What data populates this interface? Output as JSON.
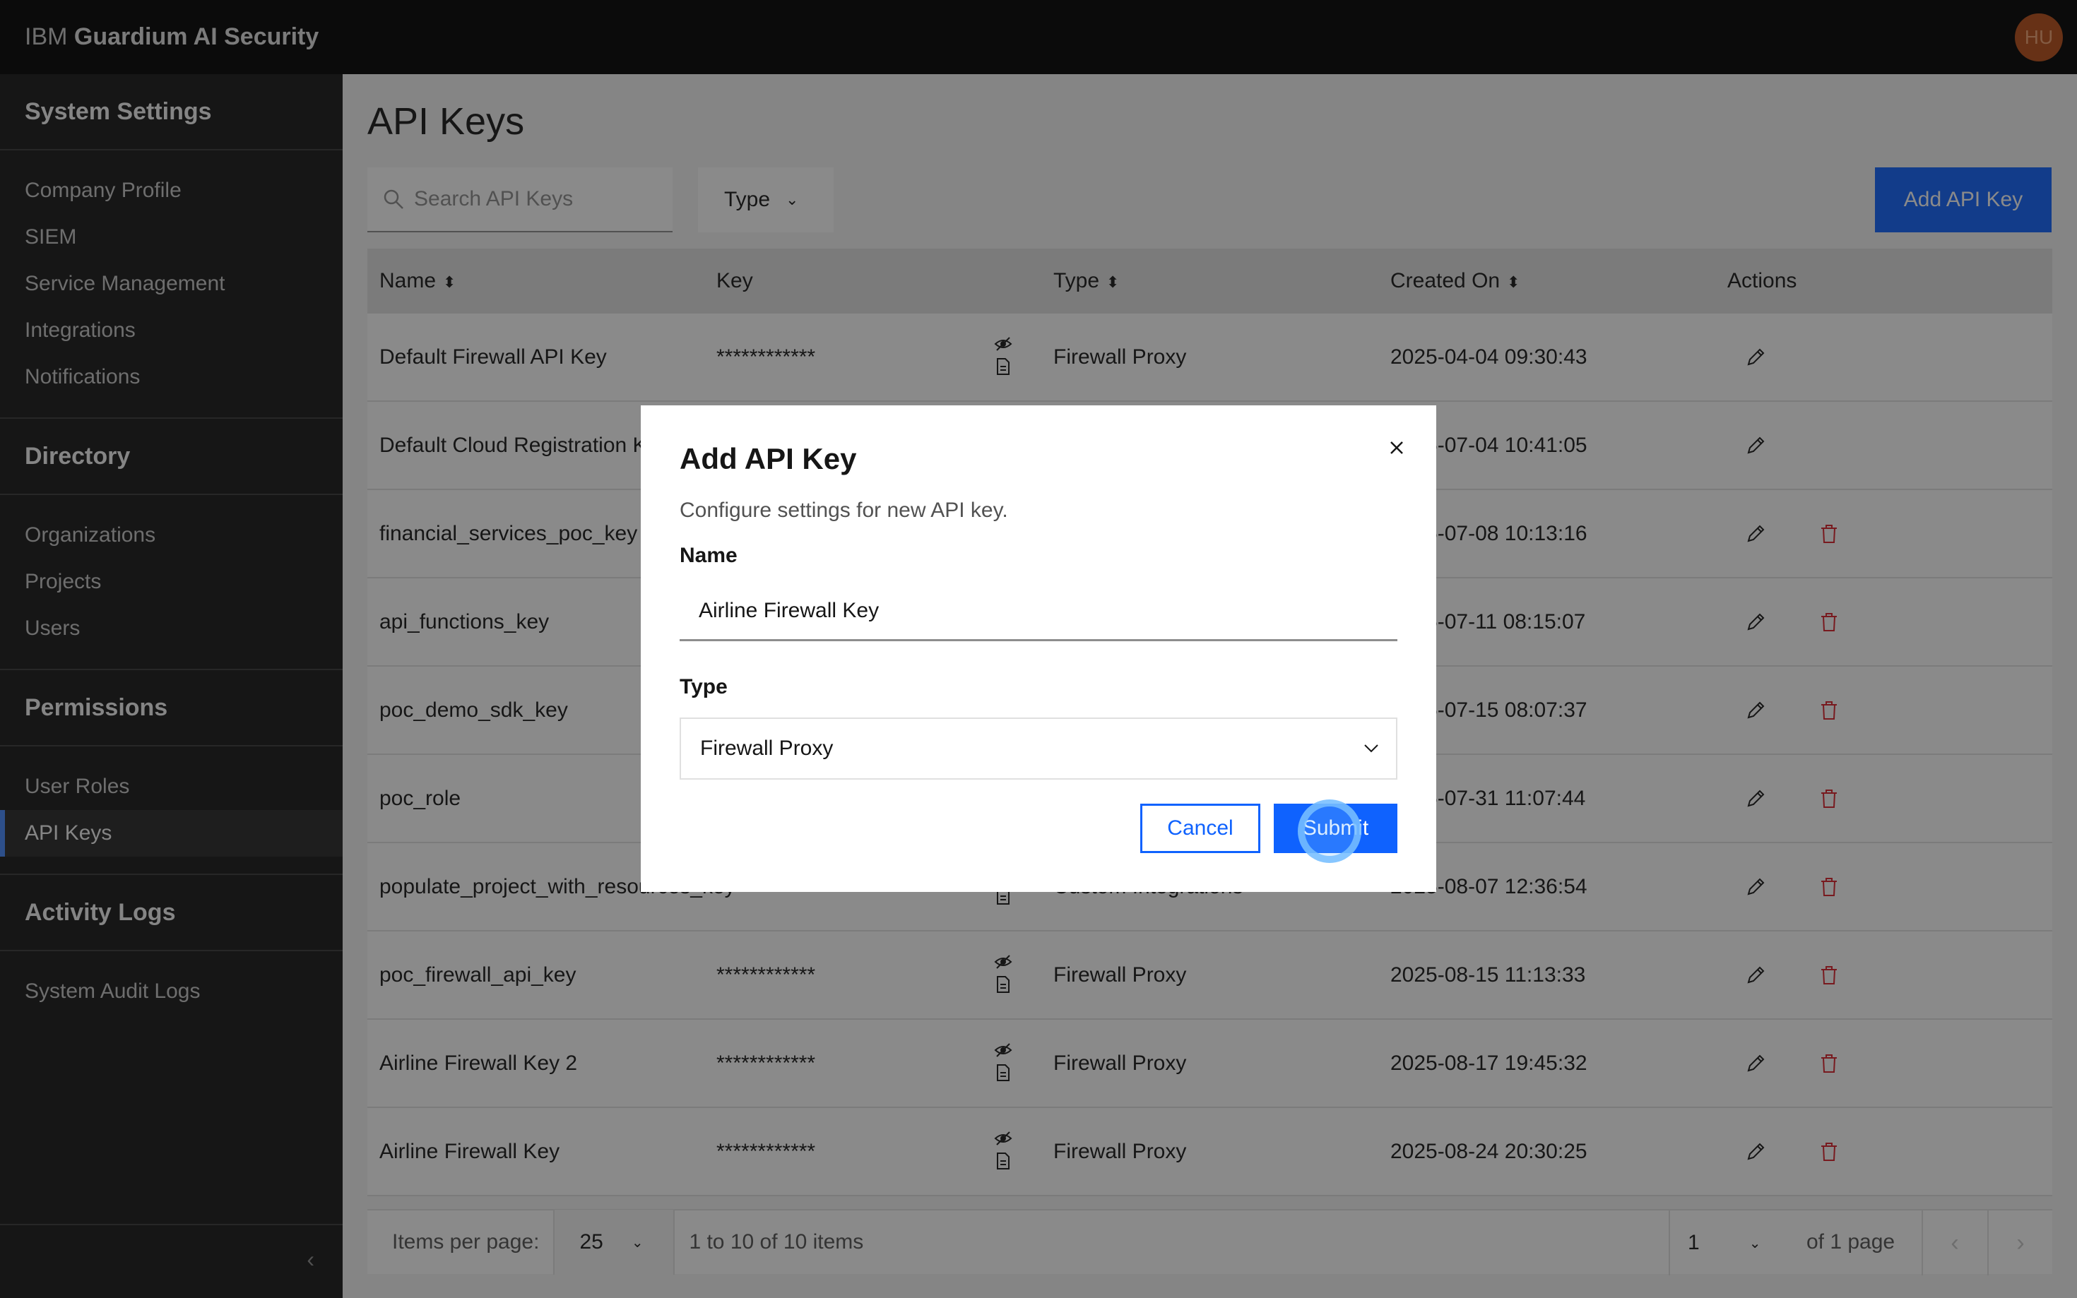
{
  "header": {
    "brand_prefix": "IBM",
    "brand_name": "Guardium AI Security",
    "avatar_initials": "HU"
  },
  "sidebar": {
    "sections": [
      {
        "heading": "System Settings",
        "items": [
          "Company Profile",
          "SIEM",
          "Service Management",
          "Integrations",
          "Notifications"
        ]
      },
      {
        "heading": "Directory",
        "items": [
          "Organizations",
          "Projects",
          "Users"
        ]
      },
      {
        "heading": "Permissions",
        "items": [
          "User Roles",
          "API Keys"
        ]
      },
      {
        "heading": "Activity Logs",
        "items": [
          "System Audit Logs"
        ]
      }
    ],
    "active_item": "API Keys"
  },
  "page": {
    "title": "API Keys",
    "search_placeholder": "Search API Keys",
    "type_filter_label": "Type",
    "add_button_label": "Add API Key"
  },
  "table": {
    "columns": {
      "name": "Name",
      "key": "Key",
      "type": "Type",
      "created": "Created On",
      "actions": "Actions"
    },
    "rows": [
      {
        "name": "Default Firewall API Key",
        "key": "************",
        "type": "Firewall Proxy",
        "created": "2025-04-04 09:30:43",
        "deletable": false
      },
      {
        "name": "Default Cloud Registration Key",
        "key": "",
        "type": "",
        "created": "2025-07-04 10:41:05",
        "deletable": false
      },
      {
        "name": "financial_services_poc_key",
        "key": "",
        "type": "",
        "created": "2025-07-08 10:13:16",
        "deletable": true
      },
      {
        "name": "api_functions_key",
        "key": "",
        "type": "",
        "created": "2025-07-11 08:15:07",
        "deletable": true
      },
      {
        "name": "poc_demo_sdk_key",
        "key": "",
        "type": "",
        "created": "2025-07-15 08:07:37",
        "deletable": true
      },
      {
        "name": "poc_role",
        "key": "",
        "type": "",
        "created": "2025-07-31 11:07:44",
        "deletable": true
      },
      {
        "name": "populate_project_with_resources_key",
        "key": "",
        "type": "Custom Integrations",
        "created": "2025-08-07 12:36:54",
        "deletable": true
      },
      {
        "name": "poc_firewall_api_key",
        "key": "************",
        "type": "Firewall Proxy",
        "created": "2025-08-15 11:13:33",
        "deletable": true
      },
      {
        "name": "Airline Firewall Key 2",
        "key": "************",
        "type": "Firewall Proxy",
        "created": "2025-08-17 19:45:32",
        "deletable": true
      },
      {
        "name": "Airline Firewall Key",
        "key": "************",
        "type": "Firewall Proxy",
        "created": "2025-08-24 20:30:25",
        "deletable": true
      }
    ]
  },
  "pagination": {
    "items_per_page_label": "Items per page:",
    "items_per_page": "25",
    "range_text": "1 to 10 of 10 items",
    "page": "1",
    "of_pages": "of 1 page"
  },
  "modal": {
    "title": "Add API Key",
    "description": "Configure settings for new API key.",
    "name_label": "Name",
    "name_value": "Airline Firewall Key",
    "type_label": "Type",
    "type_value": "Firewall Proxy",
    "cancel_label": "Cancel",
    "submit_label": "Submit"
  },
  "colors": {
    "primary": "#0f62fe",
    "delete": "#da1e28",
    "sidebar_bg": "#161616",
    "header_bg": "#000000"
  }
}
